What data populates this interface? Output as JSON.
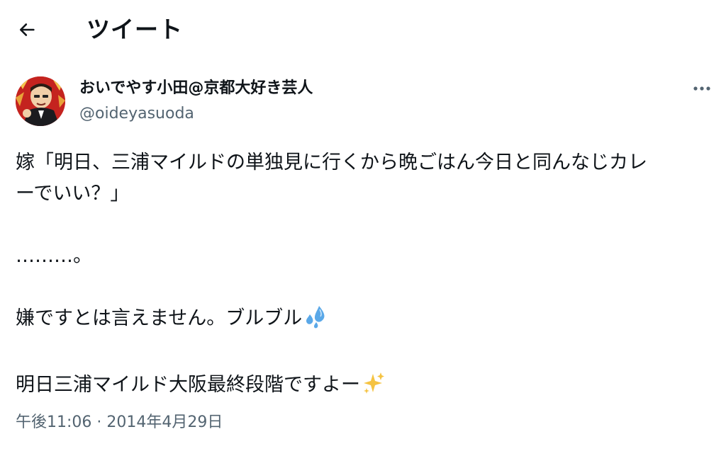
{
  "header": {
    "title": "ツイート",
    "back_icon": "arrow-left-icon"
  },
  "author": {
    "display_name": "おいでやす小田@京都大好き芸人",
    "handle": "@oideyasuoda",
    "more_icon": "more-dots-icon"
  },
  "tweet": {
    "line1": "嫁「明日、三浦マイルドの単独見に行くから晩ごはん今日と同んなじカレ",
    "line2": "ーでいい？」",
    "line3": "………。",
    "line4": "嫌ですとは言えません。ブルブル",
    "line5": "明日三浦マイルド大阪最終段階ですよー",
    "emoji1": "sweat-droplets-icon",
    "emoji2": "sparkles-icon"
  },
  "meta": {
    "timestamp": "午後11:06 · 2014年4月29日"
  },
  "colors": {
    "text": "#0f1419",
    "secondary": "#536471",
    "droplets": "#5aa8e8",
    "sparkles": "#f5c342"
  }
}
